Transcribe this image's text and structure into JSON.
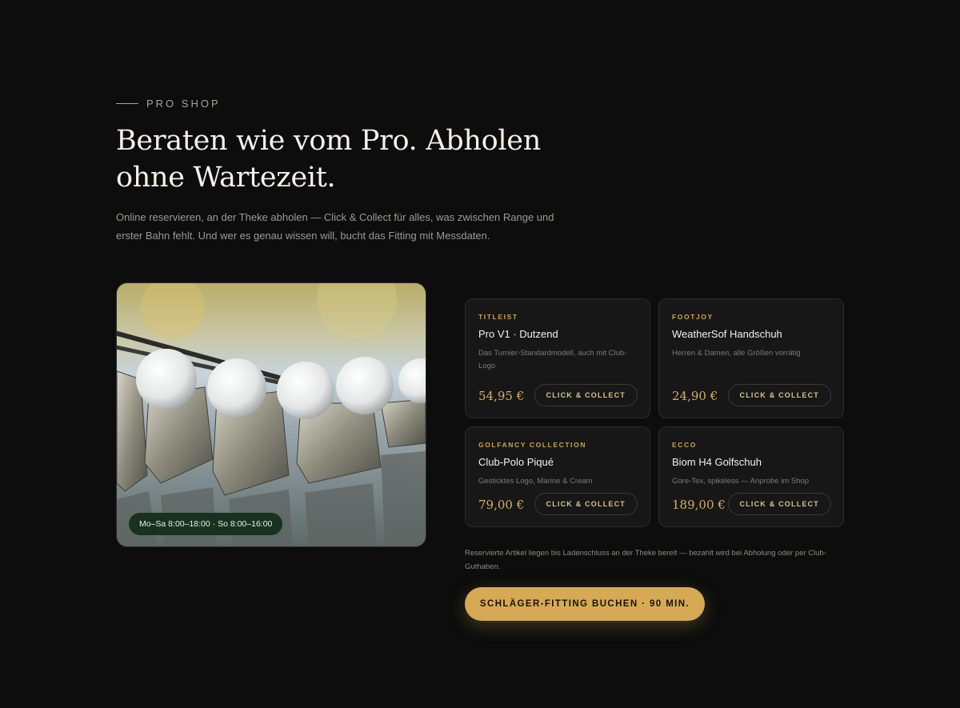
{
  "section": {
    "eyebrow": "PRO SHOP",
    "title": "Beraten wie vom Pro. Abholen ohne Wartezeit.",
    "lede": "Online reservieren, an der Theke abholen — Click & Collect für alles, was zwischen Range und erster Bahn fehlt. Und wer es genau wissen will, bucht das Fitting mit Messdaten."
  },
  "photo": {
    "hours_badge": "Mo–Sa 8:00–18:00 · So 8:00–16:00"
  },
  "products": [
    {
      "brand": "TITLEIST",
      "name": "Pro V1 · Dutzend",
      "desc": "Das Turnier-Standardmodell, auch mit Club-Logo",
      "price": "54,95 €",
      "cta": "CLICK & COLLECT"
    },
    {
      "brand": "FOOTJOY",
      "name": "WeatherSof Handschuh",
      "desc": "Herren & Damen, alle Größen vorrätig",
      "price": "24,90 €",
      "cta": "CLICK & COLLECT"
    },
    {
      "brand": "GOLFANCY COLLECTION",
      "name": "Club-Polo Piqué",
      "desc": "Gesticktes Logo, Marine & Cream",
      "price": "79,00 €",
      "cta": "CLICK & COLLECT"
    },
    {
      "brand": "ECCO",
      "name": "Biom H4 Golfschuh",
      "desc": "Gore-Tex, spikeless — Anprobe im Shop",
      "price": "189,00 €",
      "cta": "CLICK & COLLECT"
    }
  ],
  "note": "Reservierte Artikel liegen bis Ladenschluss an der Theke bereit — bezahlt wird bei Abholung oder per Club-Guthaben.",
  "fitting_button": "SCHLÄGER-FITTING BUCHEN · 90 MIN.",
  "colors": {
    "background": "#0c0d0c",
    "accent": "#d6aa55",
    "card": "#161716",
    "badge": "#18321f"
  }
}
